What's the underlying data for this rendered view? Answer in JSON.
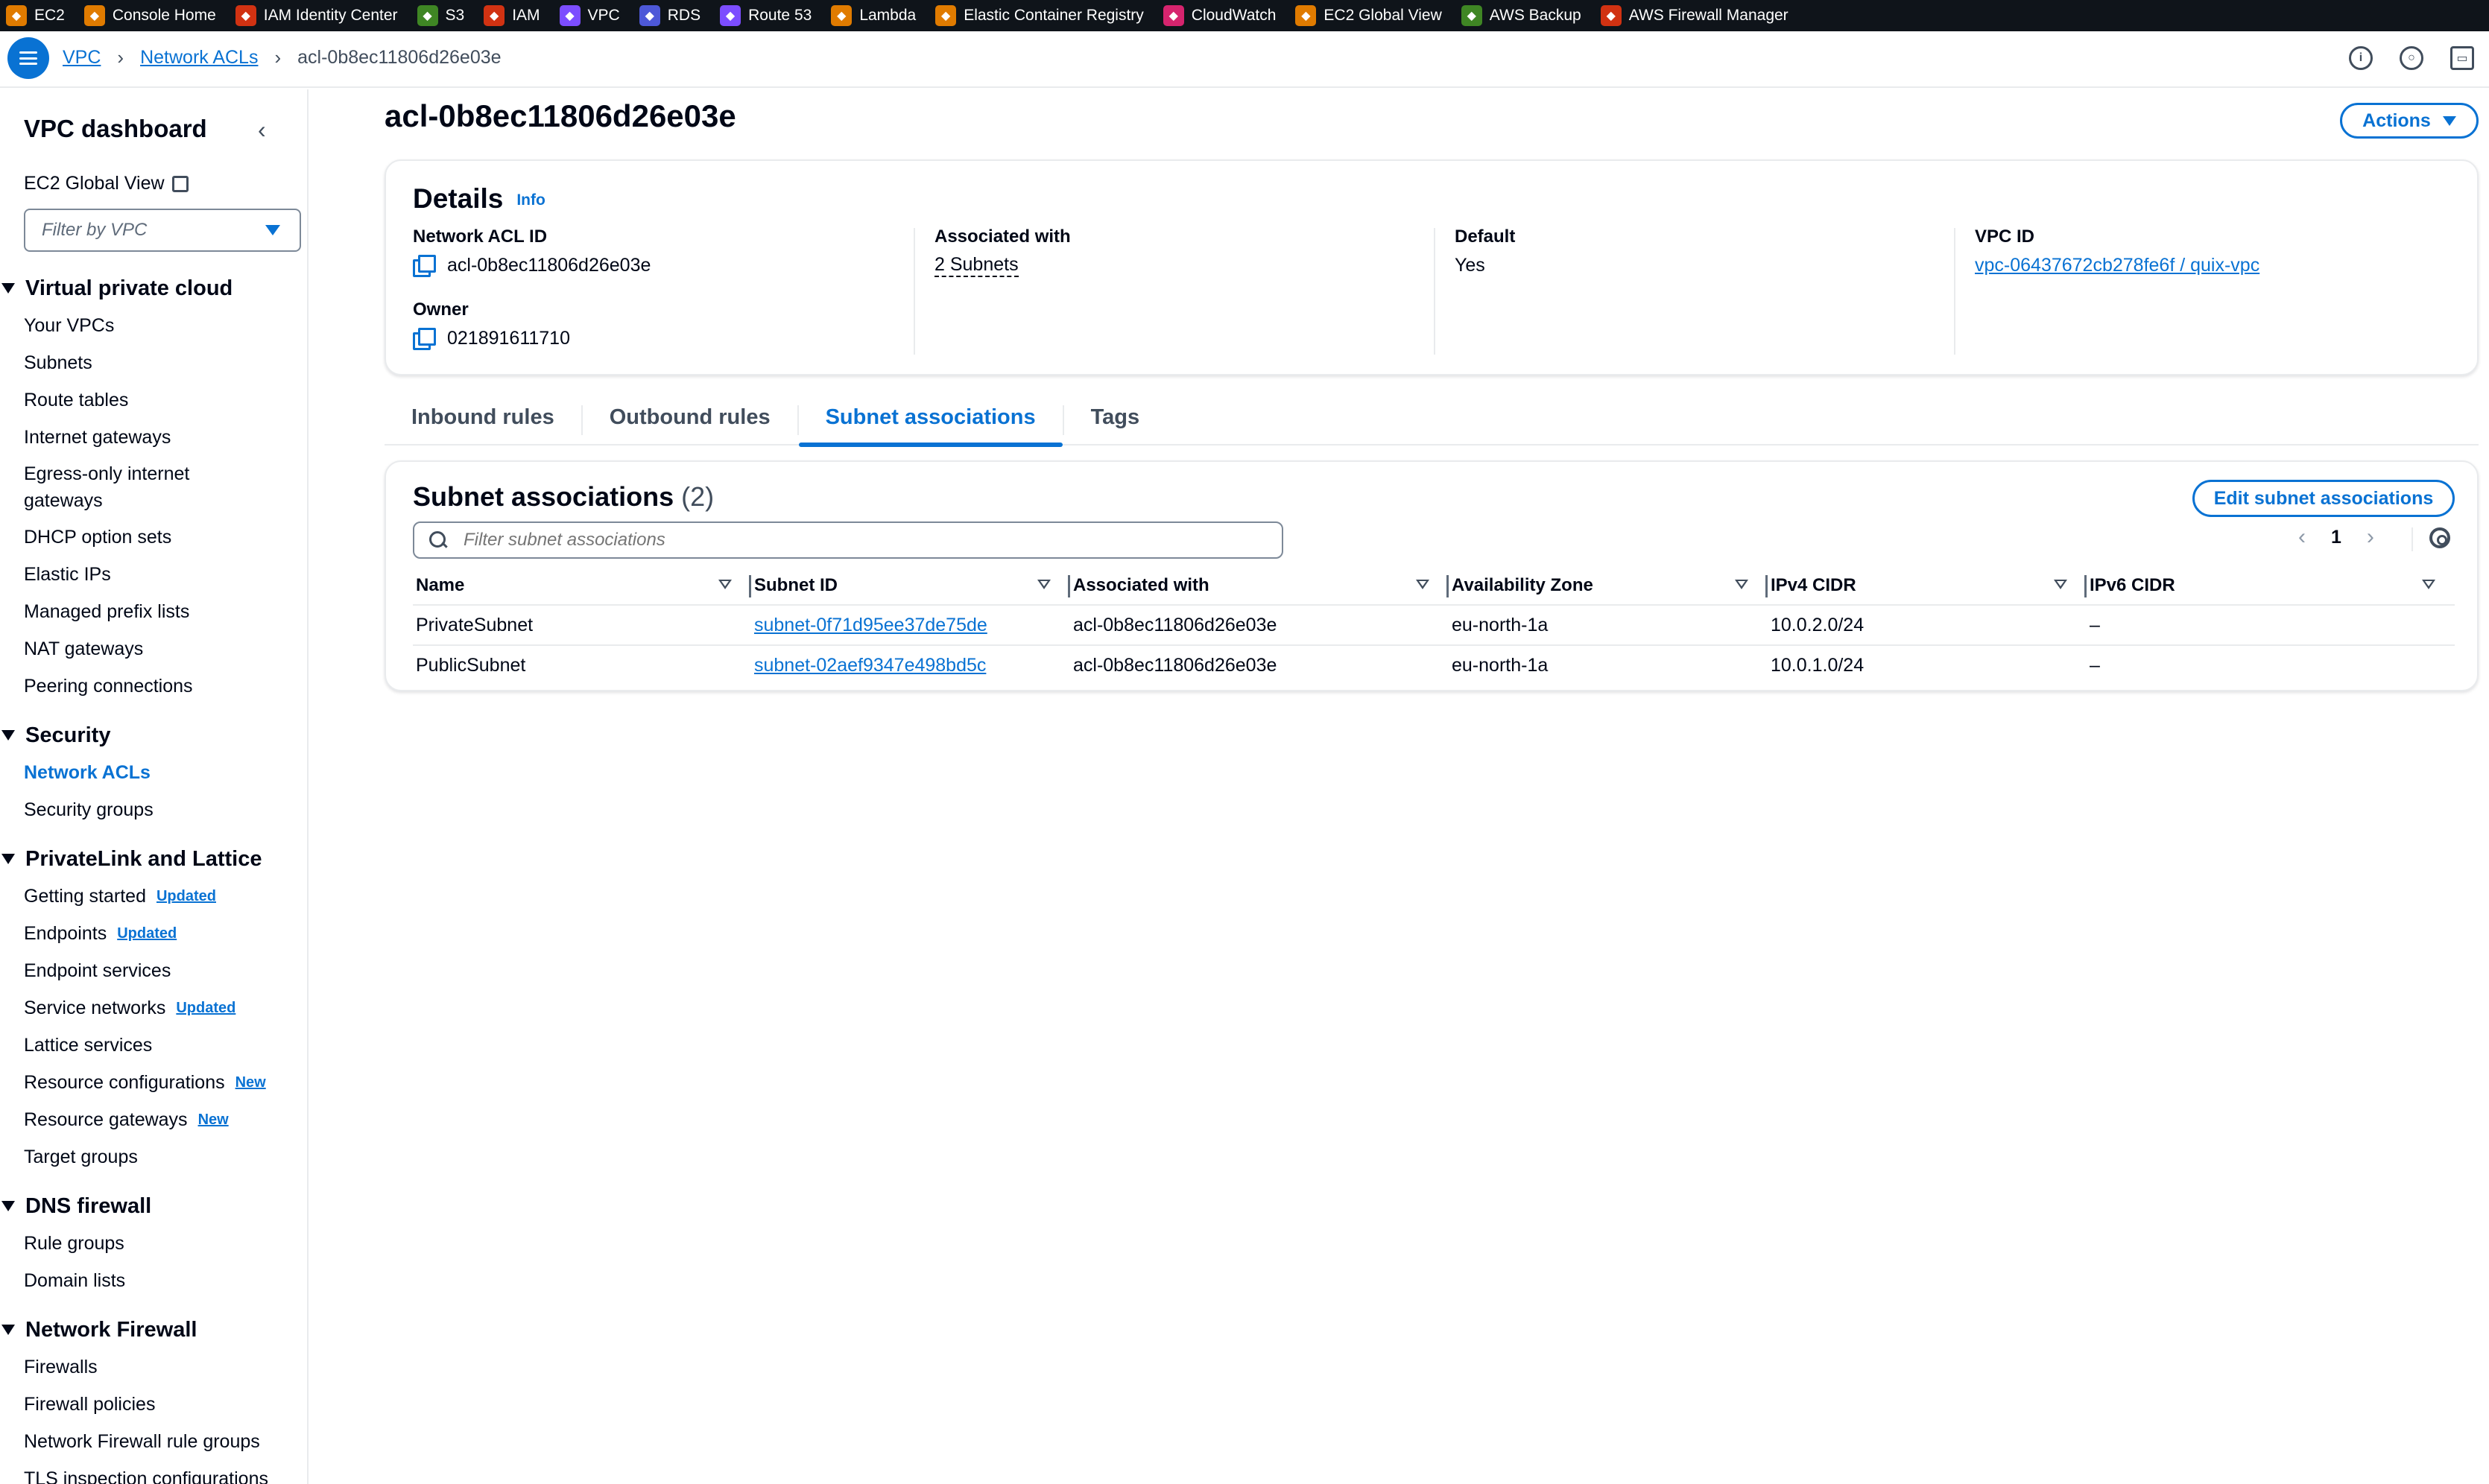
{
  "favorites": [
    {
      "label": "EC2",
      "icon": "ec2-icon",
      "color": "#e07b00"
    },
    {
      "label": "Console Home",
      "icon": "console-home-icon",
      "color": "#e07b00"
    },
    {
      "label": "IAM Identity Center",
      "icon": "iam-identity-center-icon",
      "color": "#d13212"
    },
    {
      "label": "S3",
      "icon": "s3-icon",
      "color": "#3f8624"
    },
    {
      "label": "IAM",
      "icon": "iam-icon",
      "color": "#d13212"
    },
    {
      "label": "VPC",
      "icon": "vpc-icon",
      "color": "#7c4dff"
    },
    {
      "label": "RDS",
      "icon": "rds-icon",
      "color": "#4d58d8"
    },
    {
      "label": "Route 53",
      "icon": "route53-icon",
      "color": "#7c4dff"
    },
    {
      "label": "Lambda",
      "icon": "lambda-icon",
      "color": "#e07b00"
    },
    {
      "label": "Elastic Container Registry",
      "icon": "ecr-icon",
      "color": "#e07b00"
    },
    {
      "label": "CloudWatch",
      "icon": "cloudwatch-icon",
      "color": "#d6246e"
    },
    {
      "label": "EC2 Global View",
      "icon": "ec2-global-view-icon",
      "color": "#e07b00"
    },
    {
      "label": "AWS Backup",
      "icon": "aws-backup-icon",
      "color": "#3f8624"
    },
    {
      "label": "AWS Firewall Manager",
      "icon": "firewall-manager-icon",
      "color": "#d13212"
    }
  ],
  "breadcrumb": {
    "root": "VPC",
    "section": "Network ACLs",
    "current": "acl-0b8ec11806d26e03e"
  },
  "sidebar": {
    "title": "VPC dashboard",
    "ec2_global_view": "EC2 Global View",
    "filter_placeholder": "Filter by VPC",
    "sections": [
      {
        "title": "Virtual private cloud",
        "items": [
          {
            "label": "Your VPCs"
          },
          {
            "label": "Subnets"
          },
          {
            "label": "Route tables"
          },
          {
            "label": "Internet gateways"
          },
          {
            "label": "Egress-only internet gateways"
          },
          {
            "label": "DHCP option sets"
          },
          {
            "label": "Elastic IPs"
          },
          {
            "label": "Managed prefix lists"
          },
          {
            "label": "NAT gateways"
          },
          {
            "label": "Peering connections"
          }
        ]
      },
      {
        "title": "Security",
        "items": [
          {
            "label": "Network ACLs",
            "active": true
          },
          {
            "label": "Security groups"
          }
        ]
      },
      {
        "title": "PrivateLink and Lattice",
        "items": [
          {
            "label": "Getting started",
            "badge": "Updated"
          },
          {
            "label": "Endpoints",
            "badge": "Updated"
          },
          {
            "label": "Endpoint services"
          },
          {
            "label": "Service networks",
            "badge": "Updated"
          },
          {
            "label": "Lattice services"
          },
          {
            "label": "Resource configurations",
            "badge": "New"
          },
          {
            "label": "Resource gateways",
            "badge": "New"
          },
          {
            "label": "Target groups"
          }
        ]
      },
      {
        "title": "DNS firewall",
        "items": [
          {
            "label": "Rule groups"
          },
          {
            "label": "Domain lists"
          }
        ]
      },
      {
        "title": "Network Firewall",
        "items": [
          {
            "label": "Firewalls"
          },
          {
            "label": "Firewall policies"
          },
          {
            "label": "Network Firewall rule groups"
          },
          {
            "label": "TLS inspection configurations"
          }
        ]
      }
    ]
  },
  "page": {
    "title": "acl-0b8ec11806d26e03e",
    "actions_label": "Actions"
  },
  "details": {
    "heading": "Details",
    "info": "Info",
    "network_acl_id_label": "Network ACL ID",
    "network_acl_id": "acl-0b8ec11806d26e03e",
    "owner_label": "Owner",
    "owner": "021891611710",
    "associated_with_label": "Associated with",
    "associated_with": "2 Subnets",
    "default_label": "Default",
    "default": "Yes",
    "vpc_id_label": "VPC ID",
    "vpc_id": "vpc-06437672cb278fe6f / quix-vpc"
  },
  "tabs": [
    {
      "label": "Inbound rules",
      "active": false
    },
    {
      "label": "Outbound rules",
      "active": false
    },
    {
      "label": "Subnet associations",
      "active": true
    },
    {
      "label": "Tags",
      "active": false
    }
  ],
  "subnet_associations": {
    "heading": "Subnet associations",
    "count": "(2)",
    "edit_label": "Edit subnet associations",
    "filter_placeholder": "Filter subnet associations",
    "page": "1",
    "columns": [
      "Name",
      "Subnet ID",
      "Associated with",
      "Availability Zone",
      "IPv4 CIDR",
      "IPv6 CIDR"
    ],
    "rows": [
      {
        "name": "PrivateSubnet",
        "subnet_id": "subnet-0f71d95ee37de75de",
        "associated_with": "acl-0b8ec11806d26e03e",
        "az": "eu-north-1a",
        "ipv4": "10.0.2.0/24",
        "ipv6": "–"
      },
      {
        "name": "PublicSubnet",
        "subnet_id": "subnet-02aef9347e498bd5c",
        "associated_with": "acl-0b8ec11806d26e03e",
        "az": "eu-north-1a",
        "ipv4": "10.0.1.0/24",
        "ipv6": "–"
      }
    ]
  }
}
